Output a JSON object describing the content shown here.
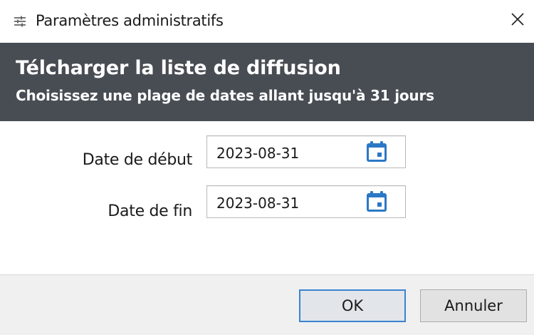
{
  "window": {
    "title": "Paramètres administratifs",
    "icon": "sliders-icon",
    "close_icon": "close-icon"
  },
  "header": {
    "title": "Télcharger la liste de diffusion",
    "subtitle": "Choisissez une plage de dates allant jusqu'à 31 jours",
    "background": "#474d53"
  },
  "form": {
    "start": {
      "label": "Date de début",
      "value": "2023-08-31",
      "icon": "calendar-icon"
    },
    "end": {
      "label": "Date de fin",
      "value": "2023-08-31",
      "icon": "calendar-icon"
    }
  },
  "footer": {
    "ok_label": "OK",
    "cancel_label": "Annuler"
  },
  "colors": {
    "accent": "#2b78c5",
    "header_bg": "#474d53",
    "footer_bg": "#f0f0f0"
  }
}
